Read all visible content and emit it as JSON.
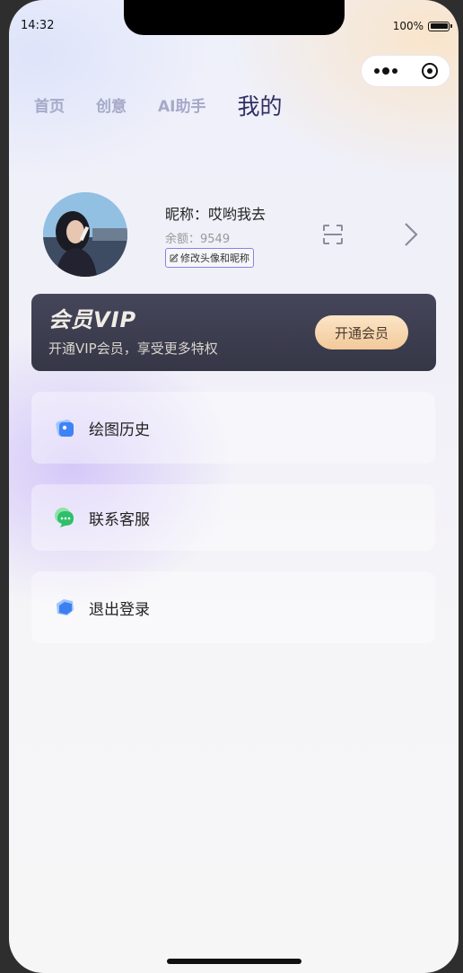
{
  "status_bar": {
    "time": "14:32",
    "battery": "100%"
  },
  "tabs": [
    {
      "label": "首页",
      "active": false
    },
    {
      "label": "创意",
      "active": false
    },
    {
      "label": "AI助手",
      "active": false
    },
    {
      "label": "我的",
      "active": true
    }
  ],
  "profile": {
    "nickname": "昵称：哎哟我去",
    "balance": "余额：9549",
    "edit_label": "修改头像和昵称"
  },
  "vip": {
    "title": "会员VIP",
    "subtitle": "开通VIP会员，享受更多特权",
    "button_label": "开通会员"
  },
  "menu": [
    {
      "label": "绘图历史",
      "icon": "drawing-history-icon"
    },
    {
      "label": "联系客服",
      "icon": "chat-bubble-icon"
    },
    {
      "label": "退出登录",
      "icon": "logout-icon"
    }
  ],
  "colors": {
    "accent": "#2f2f66",
    "tab_inactive": "#a6a9c8",
    "vip_bg": "#3b3c4e",
    "vip_button": "#f3c99a",
    "edit_border": "#8b82e4"
  }
}
